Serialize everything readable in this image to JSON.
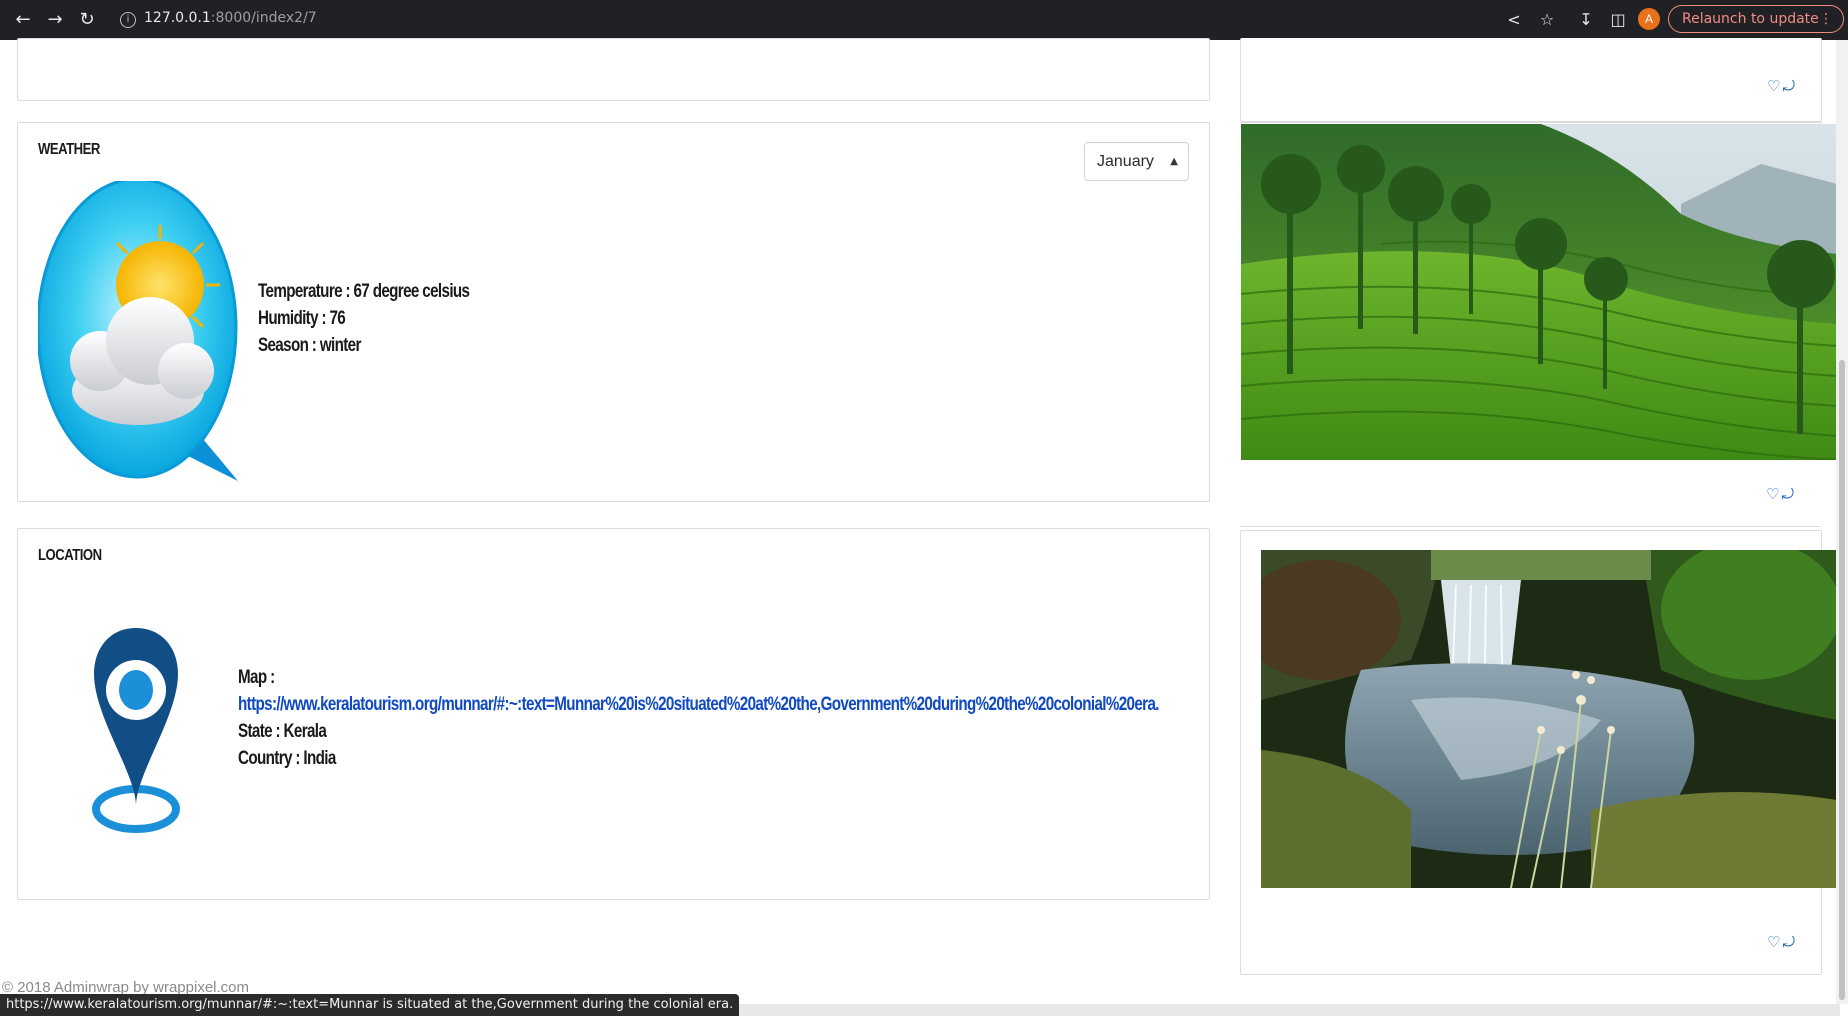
{
  "browser": {
    "url_host": "127.0.0.1",
    "url_path": ":8000/index2/7",
    "avatar_letter": "A",
    "relaunch_label": "Relaunch to update",
    "icons": [
      "back-icon",
      "forward-icon",
      "reload-icon",
      "info-icon",
      "share-icon",
      "star-icon",
      "download-icon",
      "sidebar-icon",
      "menu-dots-icon"
    ]
  },
  "weather": {
    "title": "WEATHER",
    "month_selected": "January",
    "temperature": "Temperature : 67 degree celsius",
    "humidity": "Humidity : 76",
    "season": "Season : winter",
    "icon": "weather-partly-cloudy-icon"
  },
  "location": {
    "title": "LOCATION",
    "map_label": "Map :",
    "map_link": "https://www.keralatourism.org/munnar/#:~:text=Munnar%20is%20situated%20at%20the,Government%20during%20the%20colonial%20era.",
    "state": "State : Kerala",
    "country": "Country : India",
    "icon": "map-pin-icon"
  },
  "gallery": {
    "items": [
      {
        "name": "tea-plantation",
        "actions": [
          "heart-icon",
          "share-icon"
        ]
      },
      {
        "name": "waterfall",
        "actions": [
          "heart-icon",
          "share-icon"
        ]
      }
    ]
  },
  "footer": {
    "text": "© 2018 Adminwrap by wrappixel.com"
  },
  "status_bar": {
    "text": "https://www.keralatourism.org/munnar/#:~:text=Munnar is situated at the,Government during the colonial era."
  },
  "colors": {
    "link": "#0f49c4",
    "accent": "#1565c0",
    "chrome_bg": "#202124",
    "relaunch": "#f28b82"
  }
}
